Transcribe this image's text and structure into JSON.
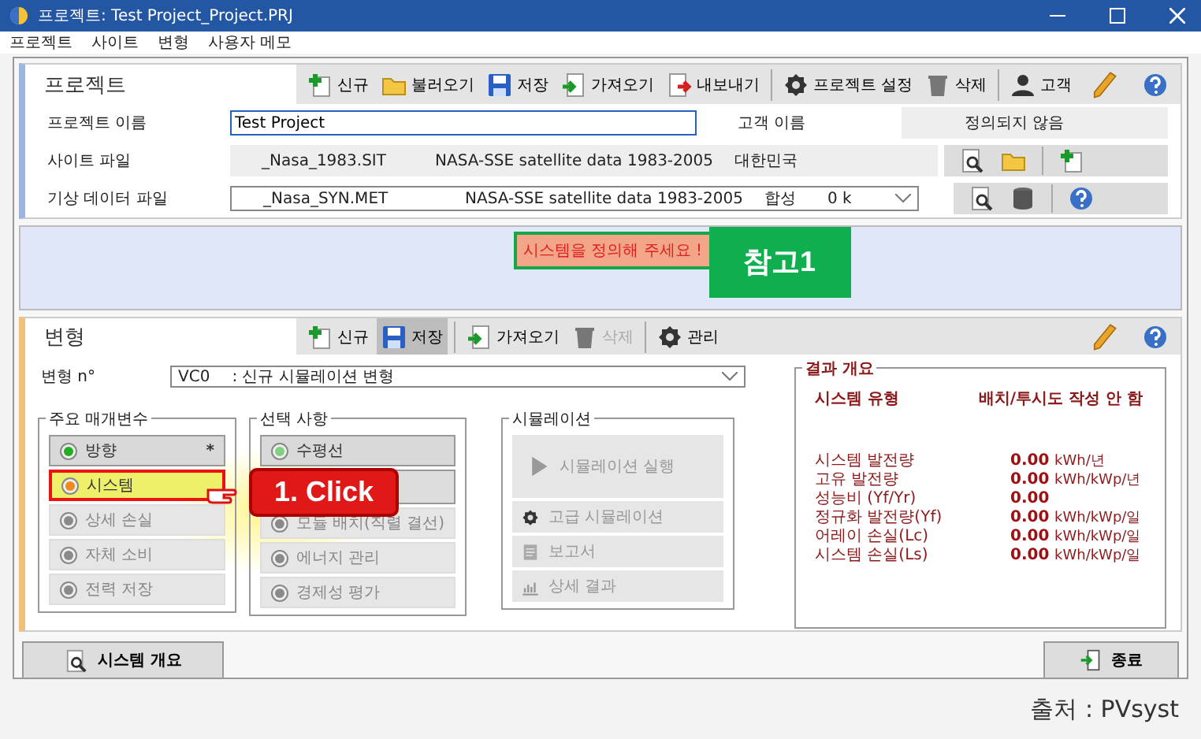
{
  "window": {
    "title": "프로젝트: Test Project_Project.PRJ"
  },
  "menu": [
    "프로젝트",
    "사이트",
    "변형",
    "사용자 메모"
  ],
  "project": {
    "title": "프로젝트",
    "toolbar": [
      [
        {
          "label": "신규",
          "kind": "plus"
        },
        {
          "label": "불러오기",
          "kind": "folder"
        },
        {
          "label": "저장",
          "kind": "save"
        },
        {
          "label": "가져오기",
          "kind": "import"
        },
        {
          "label": "내보내기",
          "kind": "export"
        }
      ],
      [
        {
          "label": "프로젝트 설정",
          "kind": "gear"
        },
        {
          "label": "삭제",
          "kind": "trash"
        }
      ],
      [
        {
          "label": "고객",
          "kind": "person"
        }
      ]
    ],
    "name_label": "프로젝트 이름",
    "name_value": "Test Project",
    "client_label": "고객 이름",
    "client_value": "정의되지 않음",
    "site_label": "사이트 파일",
    "site_file": "_Nasa_1983.SIT",
    "site_source": "NASA-SSE satellite data 1983-2005",
    "site_country": "대한민국",
    "meteo_label": "기상 데이터 파일",
    "meteo_file": "_Nasa_SYN.MET",
    "meteo_source": "NASA-SSE satellite data 1983-2005",
    "meteo_type": "합성",
    "meteo_extra": "0 k"
  },
  "notice": {
    "message": "시스템을 정의해 주세요 !",
    "callout": "참고1"
  },
  "variant": {
    "title": "변형",
    "toolbar": [
      [
        {
          "label": "신규",
          "kind": "plus",
          "selected": false,
          "disabled": false
        },
        {
          "label": "저장",
          "kind": "save",
          "selected": true,
          "disabled": false
        }
      ],
      [
        {
          "label": "가져오기",
          "kind": "import",
          "selected": false,
          "disabled": false
        },
        {
          "label": "삭제",
          "kind": "trash",
          "selected": false,
          "disabled": true
        }
      ],
      [
        {
          "label": "관리",
          "kind": "gear",
          "selected": false,
          "disabled": false
        }
      ]
    ],
    "number_label": "변형 n°",
    "number_code": "VC0",
    "number_name": ": 신규 시뮬레이션 변형",
    "main_parameters": {
      "title": "주요 매개변수",
      "items": [
        {
          "label": "방향",
          "color": "#22b022",
          "disabled": false,
          "highlighted": false,
          "marker": "*"
        },
        {
          "label": "시스템",
          "color": "#f08a1a",
          "disabled": false,
          "highlighted": true
        },
        {
          "label": "상세 손실",
          "color": "#8a8a8a",
          "disabled": true,
          "highlighted": false
        },
        {
          "label": "자체 소비",
          "color": "#8a8a8a",
          "disabled": true,
          "highlighted": false
        },
        {
          "label": "전력 저장",
          "color": "#8a8a8a",
          "disabled": true,
          "highlighted": false
        }
      ]
    },
    "optional": {
      "title": "선택 사항",
      "items": [
        {
          "label": "수평선",
          "color": "#7fd07f",
          "disabled": false
        },
        {
          "label": "모듈 배치(직렬 결선)",
          "color": "#8a8a8a",
          "disabled": true
        },
        {
          "label": "에너지 관리",
          "color": "#8a8a8a",
          "disabled": true
        },
        {
          "label": "경제성 평가",
          "color": "#8a8a8a",
          "disabled": true
        }
      ]
    },
    "simulation": {
      "title": "시뮬레이션",
      "items": [
        {
          "label": "시뮬레이션 실행",
          "kind": "play",
          "disabled": true
        },
        {
          "label": "고급 시뮬레이션",
          "kind": "gear",
          "disabled": true
        },
        {
          "label": "보고서",
          "kind": "report",
          "disabled": true
        },
        {
          "label": "상세 결과",
          "kind": "chart",
          "disabled": true
        }
      ]
    },
    "results": {
      "title": "결과 개요",
      "system_type_label": "시스템 유형",
      "system_type_value": "배치/투시도 작성 안 함",
      "rows": [
        {
          "label": "시스템 발전량",
          "value": "0.00",
          "unit": "kWh/년"
        },
        {
          "label": "고유 발전량",
          "value": "0.00",
          "unit": "kWh/kWp/년"
        },
        {
          "label": "성능비 (Yf/Yr)",
          "value": "0.00"
        },
        {
          "label": "정규화 발전량(Yf)",
          "value": "0.00",
          "unit": "kWh/kWp/일"
        },
        {
          "label": "어레이 손실(Lc)",
          "value": "0.00",
          "unit": "kWh/kWp/일"
        },
        {
          "label": "시스템 손실(Ls)",
          "value": "0.00",
          "unit": "kWh/kWp/일"
        }
      ]
    }
  },
  "annotation": {
    "label": "1. Click"
  },
  "bottom": {
    "overview": "시스템 개요",
    "exit": "종료"
  },
  "caption": "출처 : PVsyst"
}
